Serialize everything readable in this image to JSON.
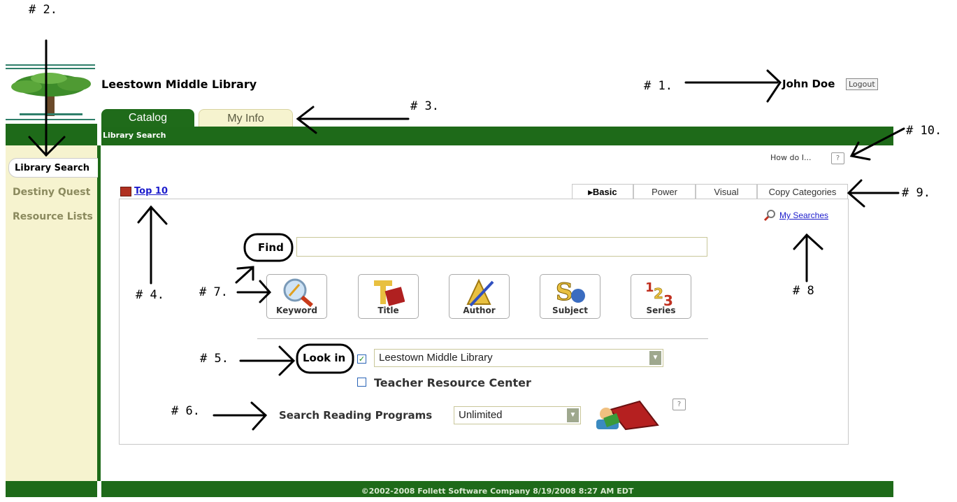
{
  "annotations": {
    "n1": "# 1.",
    "n2": "# 2.",
    "n3": "# 3.",
    "n4": "# 4.",
    "n5": "# 5.",
    "n6": "# 6.",
    "n7": "# 7.",
    "n8": "# 8",
    "n9": "# 9.",
    "n10": "# 10."
  },
  "header": {
    "site_title": "Leestown Middle Library",
    "user_name": "John Doe",
    "logout_label": "Logout"
  },
  "tabs": {
    "catalog": "Catalog",
    "my_info": "My Info"
  },
  "subnav": {
    "label": "Library Search"
  },
  "sidebar": {
    "active": "Library Search",
    "items": [
      "Destiny Quest",
      "Resource Lists"
    ]
  },
  "help": {
    "how_do_i": "How do I...",
    "help_icon": "?"
  },
  "search_tabs": [
    "Basic",
    "Power",
    "Visual",
    "Copy Categories"
  ],
  "top10": {
    "label": "Top 10"
  },
  "my_searches": "My Searches",
  "find": {
    "label": "Find",
    "value": ""
  },
  "search_buttons": [
    "Keyword",
    "Title",
    "Author",
    "Subject",
    "Series"
  ],
  "look_in": {
    "label": "Look in",
    "selected": "Leestown Middle Library",
    "other_option": "Teacher Resource Center"
  },
  "reading_programs": {
    "label": "Search Reading Programs",
    "selected": "Unlimited"
  },
  "footer": {
    "text": "©2002-2008  Follett Software Company     8/19/2008 8:27 AM EDT"
  },
  "colors": {
    "brand_green": "#1e6a19",
    "sidebar_bg": "#f6f3cf",
    "link_blue": "#1c1ccc"
  }
}
